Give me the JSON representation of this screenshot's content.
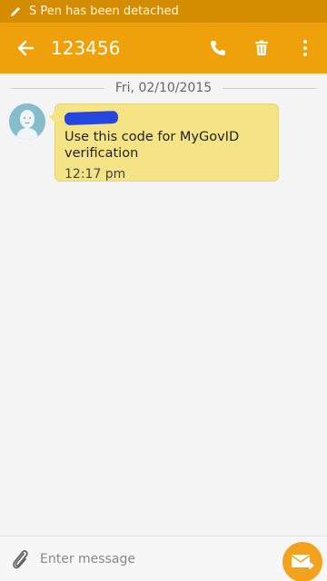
{
  "status_bar": {
    "notification": "S Pen has been detached"
  },
  "app_bar": {
    "title": "123456",
    "actions": [
      "phone-icon",
      "delete-icon",
      "more-icon"
    ]
  },
  "conversation": {
    "date": "Fri, 02/10/2015",
    "messages": [
      {
        "sender": "redacted",
        "text": "Use this code for MyGovID verification",
        "time": "12:17 pm"
      }
    ]
  },
  "compose": {
    "placeholder": "Enter message"
  },
  "colors": {
    "status_bar": "#d48c00",
    "app_bar": "#eea10a",
    "bubble": "#f5e486",
    "send_button": "#f2a21c"
  }
}
